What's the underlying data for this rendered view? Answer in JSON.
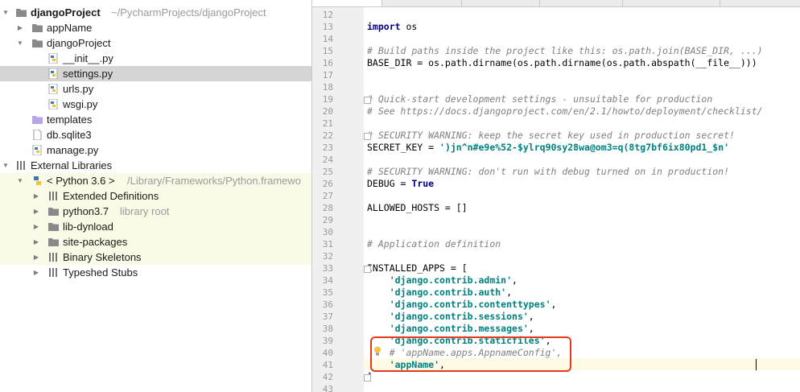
{
  "project_tree": {
    "root": {
      "name": "djangoProject",
      "path": "~/PycharmProjects/djangoProject"
    },
    "items": [
      {
        "label": "appName",
        "hint": ""
      },
      {
        "label": "djangoProject",
        "hint": ""
      },
      {
        "label": "__init__.py",
        "hint": ""
      },
      {
        "label": "settings.py",
        "hint": ""
      },
      {
        "label": "urls.py",
        "hint": ""
      },
      {
        "label": "wsgi.py",
        "hint": ""
      },
      {
        "label": "templates",
        "hint": ""
      },
      {
        "label": "db.sqlite3",
        "hint": ""
      },
      {
        "label": "manage.py",
        "hint": ""
      },
      {
        "label": "External Libraries",
        "hint": ""
      },
      {
        "label": "< Python 3.6 >",
        "hint": "/Library/Frameworks/Python.framewo"
      },
      {
        "label": "Extended Definitions",
        "hint": ""
      },
      {
        "label": "python3.7",
        "hint": "library root"
      },
      {
        "label": "lib-dynload",
        "hint": ""
      },
      {
        "label": "site-packages",
        "hint": ""
      },
      {
        "label": "Binary Skeletons",
        "hint": ""
      },
      {
        "label": "Typeshed Stubs",
        "hint": ""
      }
    ]
  },
  "editor": {
    "lines": [
      {
        "n": "12",
        "t": ""
      },
      {
        "n": "13",
        "t": "import os"
      },
      {
        "n": "14",
        "t": ""
      },
      {
        "n": "15",
        "t": "# Build paths inside the project like this: os.path.join(BASE_DIR, ...)"
      },
      {
        "n": "16",
        "t": "BASE_DIR = os.path.dirname(os.path.dirname(os.path.abspath(__file__)))"
      },
      {
        "n": "17",
        "t": ""
      },
      {
        "n": "18",
        "t": ""
      },
      {
        "n": "19",
        "t": "# Quick-start development settings - unsuitable for production"
      },
      {
        "n": "20",
        "t": "# See https://docs.djangoproject.com/en/2.1/howto/deployment/checklist/"
      },
      {
        "n": "21",
        "t": ""
      },
      {
        "n": "22",
        "t": "# SECURITY WARNING: keep the secret key used in production secret!"
      },
      {
        "n": "23",
        "t": "SECRET_KEY = ')jn^n#e9e%52-$ylrq90sy28wa@om3=q(8tg7bf6ix80pd1_$n'"
      },
      {
        "n": "24",
        "t": ""
      },
      {
        "n": "25",
        "t": "# SECURITY WARNING: don't run with debug turned on in production!"
      },
      {
        "n": "26",
        "t": "DEBUG = True"
      },
      {
        "n": "27",
        "t": ""
      },
      {
        "n": "28",
        "t": "ALLOWED_HOSTS = []"
      },
      {
        "n": "29",
        "t": ""
      },
      {
        "n": "30",
        "t": ""
      },
      {
        "n": "31",
        "t": "# Application definition"
      },
      {
        "n": "32",
        "t": ""
      },
      {
        "n": "33",
        "t": "INSTALLED_APPS = ["
      },
      {
        "n": "34",
        "t": "    'django.contrib.admin',"
      },
      {
        "n": "35",
        "t": "    'django.contrib.auth',"
      },
      {
        "n": "36",
        "t": "    'django.contrib.contenttypes',"
      },
      {
        "n": "37",
        "t": "    'django.contrib.sessions',"
      },
      {
        "n": "38",
        "t": "    'django.contrib.messages',"
      },
      {
        "n": "39",
        "t": "    'django.contrib.staticfiles',"
      },
      {
        "n": "40",
        "t": "    # 'appName.apps.AppnameConfig',"
      },
      {
        "n": "41",
        "t": "    'appName',"
      },
      {
        "n": "42",
        "t": "]"
      },
      {
        "n": "43",
        "t": ""
      }
    ]
  },
  "colors": {
    "keyword": "#000080",
    "comment": "#808080",
    "string": "#008080",
    "selection": "#d5d5d5",
    "library_bg": "#fafae6",
    "highlight_box": "#e23a1f"
  },
  "icons": [
    "folder-icon",
    "python-file-icon",
    "file-icon",
    "library-icon",
    "python-sdk-icon",
    "lightbulb-icon"
  ]
}
